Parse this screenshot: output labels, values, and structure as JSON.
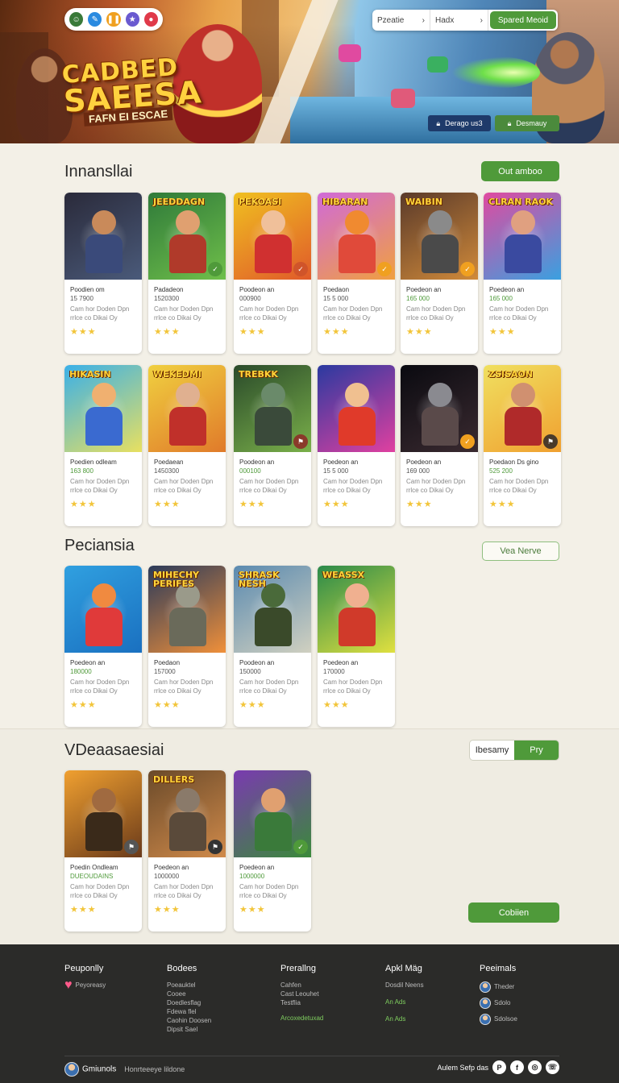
{
  "hero": {
    "title_line1": "CADBED",
    "title_line2": "SAEESA",
    "subtitle": "FAFN EI ESCAE",
    "search": {
      "field1": "Pzeatie",
      "field2": "Hadx",
      "submit_label": "Spared Meoid"
    },
    "button1_label": "Derago us3",
    "button2_label": "Desmauy"
  },
  "sections": {
    "s1": {
      "title": "Innansllai",
      "action_label": "Out amboo"
    },
    "s2": {
      "title": "Peciansia",
      "action_label": "Vea Nerve"
    },
    "s3": {
      "title": "VDeaasaesiai",
      "toggle": [
        "Ibesamy",
        "Pry"
      ],
      "more_label": "Cobiien"
    }
  },
  "cards": [
    {
      "logo": "",
      "name": "Poodien om",
      "price": "15 7900",
      "desc": "Cam hor Doden Dpn rrlce co Dikai Oy",
      "stars": "★★★",
      "green": false,
      "badge": "",
      "bg": [
        "#2a2a3a",
        "#4a5a7a"
      ],
      "skin": "#c98a5a",
      "suit": "#3a4a7a",
      "badgeColor": ""
    },
    {
      "logo": "JEEDDAGN",
      "name": "Padadeon",
      "price": "1520300",
      "desc": "Cam hor Doden Dpn rrlce co Dikai Oy",
      "stars": "★★★",
      "green": false,
      "badge": "✓",
      "bg": [
        "#2f7a3a",
        "#6fbf4a"
      ],
      "skin": "#e0a070",
      "suit": "#b03a2a",
      "badgeColor": "#4f9a3a"
    },
    {
      "logo": "PEKOASI",
      "name": "Poodeon an",
      "price": "000900",
      "desc": "Cam hor Doden Dpn rrlce co Dikai Oy",
      "stars": "★★★",
      "green": false,
      "badge": "✓",
      "bg": [
        "#f0c020",
        "#e05a2a"
      ],
      "skin": "#f0c09a",
      "suit": "#d03030",
      "badgeColor": "#d0542a"
    },
    {
      "logo": "HIBARAN",
      "name": "Poedaon",
      "price": "15 5 000",
      "desc": "Cam hor Doden Dpn rrlce co Dikai Oy",
      "stars": "★★★",
      "green": false,
      "badge": "✓",
      "bg": [
        "#d06ad8",
        "#f0a040"
      ],
      "skin": "#f08a30",
      "suit": "#e04a3a",
      "badgeColor": "#f0a020"
    },
    {
      "logo": "WAIBIN",
      "name": "Poedeon an",
      "price": "165 000",
      "desc": "Cam hor Doden Dpn rrlce co Dikai Oy",
      "stars": "★★★",
      "green": true,
      "badge": "✓",
      "bg": [
        "#5a3a2a",
        "#d08a3a"
      ],
      "skin": "#8a8a8a",
      "suit": "#4a4a4a",
      "badgeColor": "#f0a020"
    },
    {
      "logo": "CLRAN RAOK",
      "name": "Poedeon an",
      "price": "165 000",
      "desc": "Cam hor Doden Dpn rrlce co Dikai Oy",
      "stars": "★★★",
      "green": true,
      "badge": "",
      "bg": [
        "#e04aa0",
        "#3aa0e0"
      ],
      "skin": "#e0a080",
      "suit": "#3a4aa0",
      "badgeColor": ""
    },
    {
      "logo": "HIKASIN",
      "name": "Poedien odleam",
      "price": "163 800",
      "desc": "Cam hor Doden Dpn rrlce co Dikai Oy",
      "stars": "★★★",
      "green": true,
      "badge": "",
      "bg": [
        "#3ab0e8",
        "#e8e060"
      ],
      "skin": "#f0b070",
      "suit": "#3a6ad0",
      "badgeColor": ""
    },
    {
      "logo": "WEKEDMI",
      "name": "Poedaean",
      "price": "1450300",
      "desc": "Cam hor Doden Dpn rrlce co Dikai Oy",
      "stars": "★★★",
      "green": false,
      "badge": "",
      "bg": [
        "#f0d040",
        "#e07a2a"
      ],
      "skin": "#e0b090",
      "suit": "#c0302a",
      "badgeColor": ""
    },
    {
      "logo": "TREBKK",
      "name": "Poodeon an",
      "price": "000100",
      "desc": "Cam hor Doden Dpn rrlce co Dikai Oy",
      "stars": "★★★",
      "green": true,
      "badge": "⚑",
      "bg": [
        "#2a4a2a",
        "#7ab04a"
      ],
      "skin": "#6a8a6a",
      "suit": "#3a4a3a",
      "badgeColor": "#8a3a2a"
    },
    {
      "logo": "",
      "name": "Poedeon an",
      "price": "15 5 000",
      "desc": "Cam hor Doden Dpn rrlce co Dikai Oy",
      "stars": "★★★",
      "green": false,
      "badge": "",
      "bg": [
        "#2a3aa0",
        "#e040a0"
      ],
      "skin": "#f0c090",
      "suit": "#e03a2a",
      "badgeColor": ""
    },
    {
      "logo": "",
      "name": "Poedeon an",
      "price": "169 000",
      "desc": "Cam hor Doden Dpn rrlce co Dikai Oy",
      "stars": "★★★",
      "green": false,
      "badge": "✓",
      "bg": [
        "#0a0a10",
        "#3a2a30"
      ],
      "skin": "#8a8a90",
      "suit": "#5a4a4a",
      "badgeColor": "#f0a020"
    },
    {
      "logo": "ZSISAON",
      "name": "Poedaon Ds gino",
      "price": "525 200",
      "desc": "Cam hor Doden Dpn rrlce co Dikai Oy",
      "stars": "★★★",
      "green": true,
      "badge": "⚑",
      "bg": [
        "#f0e060",
        "#f0a030"
      ],
      "skin": "#d09070",
      "suit": "#b02a2a",
      "badgeColor": "#4a3a2a"
    },
    {
      "logo": "",
      "name": "Poedeon an",
      "price": "180000",
      "desc": "Cam hor Doden Dpn rrlce co Dikai Oy",
      "stars": "★★★",
      "green": true,
      "badge": "",
      "bg": [
        "#30a0e0",
        "#1a70c0"
      ],
      "skin": "#f08a40",
      "suit": "#e03a3a",
      "badgeColor": ""
    },
    {
      "logo": "MIHECHY PERIFES",
      "name": "Poedaon",
      "price": "157000",
      "desc": "Cam hor Doden Dpn rrlce co Dikai Oy",
      "stars": "★★★",
      "green": false,
      "badge": "",
      "bg": [
        "#2a3a5a",
        "#f0903a"
      ],
      "skin": "#9a9a8a",
      "suit": "#6a6a5a",
      "badgeColor": ""
    },
    {
      "logo": "SHRASK NESH",
      "name": "Poodeon an",
      "price": "150000",
      "desc": "Cam hor Doden Dpn rrlce co Dikai Oy",
      "stars": "★★★",
      "green": false,
      "badge": "",
      "bg": [
        "#5a8ab0",
        "#d0d0c0"
      ],
      "skin": "#4a6a3a",
      "suit": "#3a4a2a",
      "badgeColor": ""
    },
    {
      "logo": "WEASSX",
      "name": "Poedeon an",
      "price": "170000",
      "desc": "Cam hor Doden Dpn rrlce co Dikai Oy",
      "stars": "★★★",
      "green": false,
      "badge": "",
      "bg": [
        "#2a8a4a",
        "#e0e040"
      ],
      "skin": "#f0b090",
      "suit": "#d03a2a",
      "badgeColor": ""
    },
    {
      "logo": "",
      "name": "Poedin Ondleam",
      "price": "DUEOUDAINS",
      "desc": "Cam hor Doden Dpn rrlce co Dikai Oy",
      "stars": "★★★",
      "green": true,
      "badge": "⚑",
      "bg": [
        "#f0a030",
        "#6a3a1a"
      ],
      "skin": "#a06a40",
      "suit": "#3a2a1a",
      "badgeColor": "#555"
    },
    {
      "logo": "DILLERS",
      "name": "Poedeon an",
      "price": "1000000",
      "desc": "Cam hor Doden Dpn rrlce co Dikai Oy",
      "stars": "★★★",
      "green": false,
      "badge": "⚑",
      "bg": [
        "#6a4a2a",
        "#d08a4a"
      ],
      "skin": "#8a7a6a",
      "suit": "#5a4a3a",
      "badgeColor": "#333"
    },
    {
      "logo": "",
      "name": "Poedeon an",
      "price": "1000000",
      "desc": "Cam hor Doden Dpn rrlce co Dikai Oy",
      "stars": "★★★",
      "green": true,
      "badge": "✓",
      "bg": [
        "#7a3ab0",
        "#3a8a3a"
      ],
      "skin": "#e0a070",
      "suit": "#3a7a3a",
      "badgeColor": "#4f9a3a"
    }
  ],
  "footer": {
    "col1": {
      "heading": "Peuponlly",
      "item1": "Peyoreasy"
    },
    "col2": {
      "heading": "Bodees",
      "items": [
        "Poeauktel",
        "Cooee",
        "Doedlesflag",
        "Fdewa flel",
        "Caohin Doosen",
        "Dipsit Sael"
      ]
    },
    "col3": {
      "heading": "Prerallng",
      "items": [
        "Cahfen",
        "Cast Leouhet",
        "Testflia",
        "Arcoxedetuxad"
      ]
    },
    "col4": {
      "heading": "Apkl Mäg",
      "items": [
        "Dosdil Neens",
        "An Ads",
        "An Ads"
      ]
    },
    "col5": {
      "heading": "Peeimals",
      "items": [
        "Theder",
        "Sdolo",
        "Sdolsoe"
      ]
    },
    "bottom": {
      "brand": "Gmiunols",
      "link": "Honrteeeye lildone",
      "social_label": "Aulem Sefp das"
    }
  }
}
